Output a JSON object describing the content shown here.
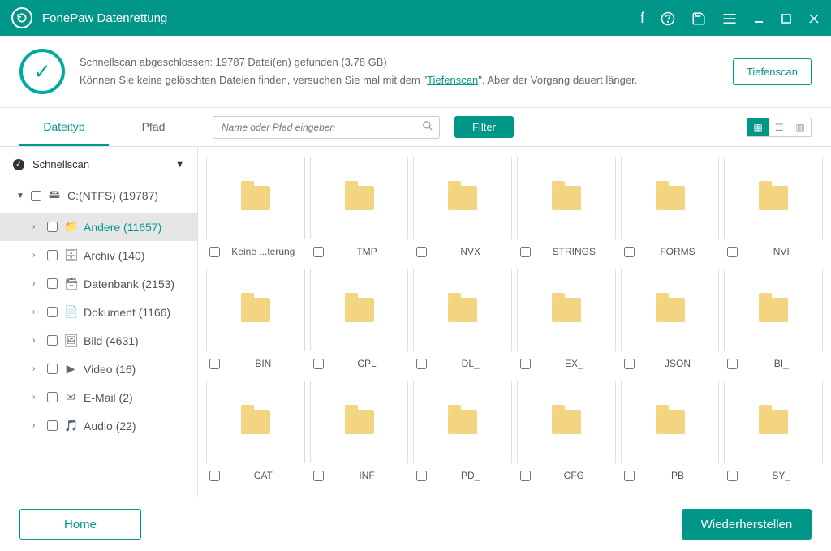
{
  "titlebar": {
    "title": "FonePaw Datenrettung"
  },
  "status": {
    "line1": "Schnellscan abgeschlossen: 19787 Datei(en) gefunden (3.78 GB)",
    "line2_a": "Können Sie keine gelöschten Dateien finden, versuchen Sie mal mit dem \"",
    "link": "Tiefenscan",
    "line2_b": "\". Aber der Vorgang dauert länger.",
    "deepscan_btn": "Tiefenscan"
  },
  "toolbar": {
    "tab_type": "Dateityp",
    "tab_path": "Pfad",
    "search_placeholder": "Name oder Pfad eingeben",
    "filter": "Filter"
  },
  "tree": {
    "head": "Schnellscan",
    "drive": "C:(NTFS) (19787)",
    "items": [
      {
        "label": "Andere (11657)",
        "icon": "📁",
        "sel": true
      },
      {
        "label": "Archiv (140)",
        "icon": "🗄"
      },
      {
        "label": "Datenbank (2153)",
        "icon": "🗃"
      },
      {
        "label": "Dokument (1166)",
        "icon": "📄"
      },
      {
        "label": "Bild (4631)",
        "icon": "🖼"
      },
      {
        "label": "Video (16)",
        "icon": "▶"
      },
      {
        "label": "E-Mail (2)",
        "icon": "✉"
      },
      {
        "label": "Audio (22)",
        "icon": "🎵"
      }
    ]
  },
  "folders": [
    [
      "Keine ...terung",
      "TMP",
      "NVX",
      "STRINGS",
      "FORMS",
      "NVI"
    ],
    [
      "BIN",
      "CPL",
      "DL_",
      "EX_",
      "JSON",
      "BI_"
    ],
    [
      "CAT",
      "INF",
      "PD_",
      "CFG",
      "PB",
      "SY_"
    ]
  ],
  "footer": {
    "home": "Home",
    "recover": "Wiederherstellen"
  }
}
